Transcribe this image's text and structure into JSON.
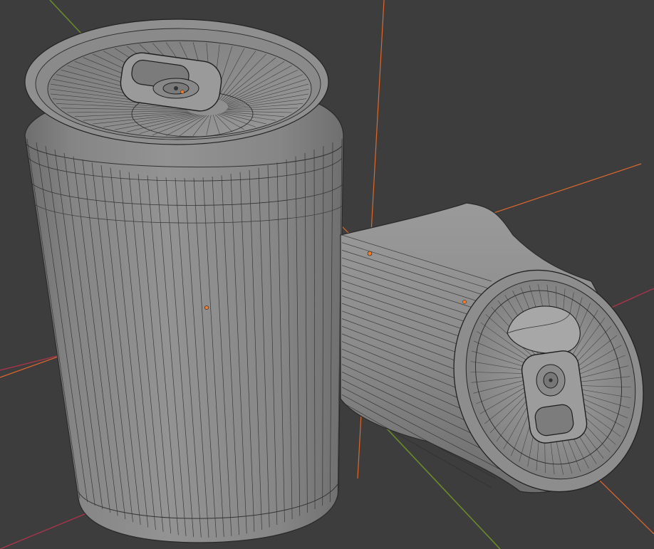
{
  "viewport": {
    "background_color": "#3d3d3d",
    "axis_x_color": "#a8344b",
    "axis_y_color": "#6a8a2c",
    "selection_outline_color": "#e0672c",
    "origin_dot_color": "#f07b2b",
    "mesh_base_color": "#8c8c8c",
    "wire_color": "#1e1e1e"
  },
  "objects": [
    {
      "name": "soda-can-upright",
      "orientation": "upright",
      "selected": false
    },
    {
      "name": "soda-can-crushed",
      "orientation": "lying",
      "selected": true
    }
  ]
}
